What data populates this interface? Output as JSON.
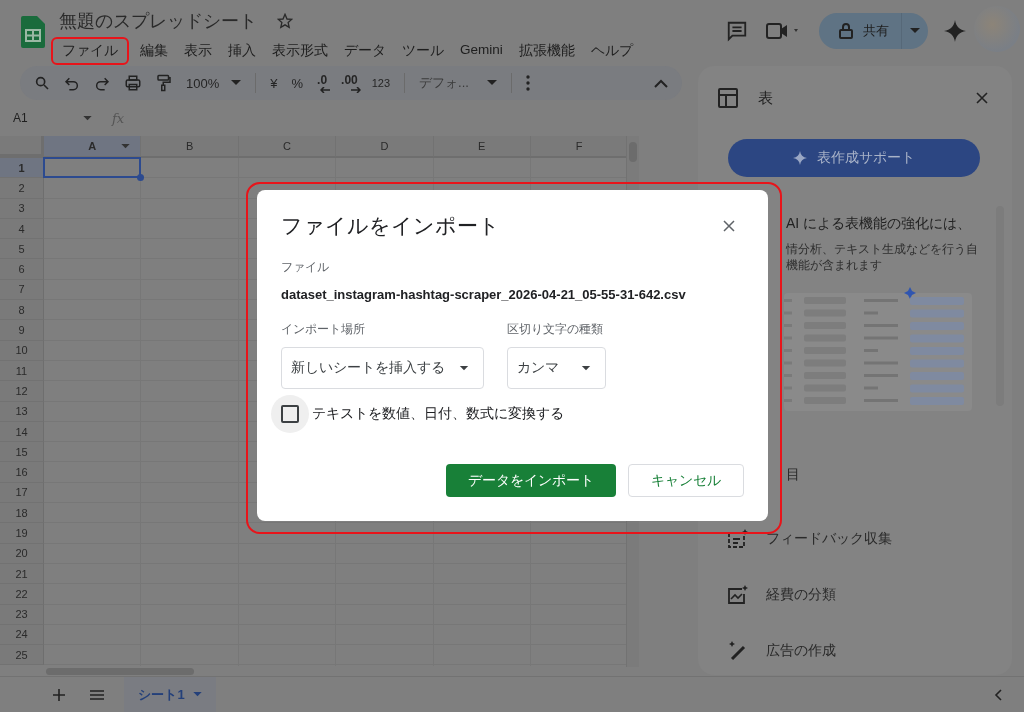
{
  "document": {
    "title": "無題のスプレッドシート",
    "starred": false
  },
  "menu": [
    {
      "label": "ファイル",
      "annotated": true
    },
    {
      "label": "編集",
      "annotated": false
    },
    {
      "label": "表示",
      "annotated": false
    },
    {
      "label": "挿入",
      "annotated": false
    },
    {
      "label": "表示形式",
      "annotated": false
    },
    {
      "label": "データ",
      "annotated": false
    },
    {
      "label": "ツール",
      "annotated": false
    },
    {
      "label": "Gemini",
      "annotated": false
    },
    {
      "label": "拡張機能",
      "annotated": false
    },
    {
      "label": "ヘルプ",
      "annotated": false
    }
  ],
  "share": {
    "label": "共有"
  },
  "toolbar": {
    "zoom": "100%",
    "currency": "¥",
    "percent": "%",
    "decrease_decimal": ".0",
    "increase_decimal": ".00",
    "number_format": "123",
    "font": "デフォ..."
  },
  "name_box": "A1",
  "formula_label": "fx",
  "grid": {
    "columns": [
      {
        "label": "A",
        "selected": true
      },
      {
        "label": "B",
        "selected": false
      },
      {
        "label": "C",
        "selected": false
      },
      {
        "label": "D",
        "selected": false
      },
      {
        "label": "E",
        "selected": false
      },
      {
        "label": "F",
        "selected": false
      }
    ],
    "rows": [
      {
        "label": "1",
        "selected": true
      },
      {
        "label": "2",
        "selected": false
      },
      {
        "label": "3",
        "selected": false
      },
      {
        "label": "4",
        "selected": false
      },
      {
        "label": "5",
        "selected": false
      },
      {
        "label": "6",
        "selected": false
      },
      {
        "label": "7",
        "selected": false
      },
      {
        "label": "8",
        "selected": false
      },
      {
        "label": "9",
        "selected": false
      },
      {
        "label": "10",
        "selected": false
      },
      {
        "label": "11",
        "selected": false
      },
      {
        "label": "12",
        "selected": false
      },
      {
        "label": "13",
        "selected": false
      },
      {
        "label": "14",
        "selected": false
      },
      {
        "label": "15",
        "selected": false
      },
      {
        "label": "16",
        "selected": false
      },
      {
        "label": "17",
        "selected": false
      },
      {
        "label": "18",
        "selected": false
      },
      {
        "label": "19",
        "selected": false
      },
      {
        "label": "20",
        "selected": false
      },
      {
        "label": "21",
        "selected": false
      },
      {
        "label": "22",
        "selected": false
      },
      {
        "label": "23",
        "selected": false
      },
      {
        "label": "24",
        "selected": false
      },
      {
        "label": "25",
        "selected": false
      }
    ]
  },
  "side_panel": {
    "title": "表",
    "primary_button": "表作成サポート",
    "intro": [
      "AI による表機能の強化には、",
      "情分析、テキスト生成などを行う自",
      "機能が含まれます"
    ],
    "items": [
      {
        "label": "目",
        "kind": "hidden"
      },
      {
        "label": "フィードバック収集",
        "kind": "feedback"
      },
      {
        "label": "経費の分類",
        "kind": "expense"
      },
      {
        "label": "広告の作成",
        "kind": "ad"
      }
    ]
  },
  "sheet_tabs": [
    {
      "label": "シート1",
      "selected": true
    }
  ],
  "dialog": {
    "title": "ファイルをインポート",
    "annotated": true,
    "file_label": "ファイル",
    "file_name": "dataset_instagram-hashtag-scraper_2026-04-21_05-55-31-642.csv",
    "fields": [
      {
        "label": "インポート場所",
        "value": "新しいシートを挿入する"
      },
      {
        "label": "区切り文字の種類",
        "value": "カンマ"
      }
    ],
    "option": {
      "label": "テキストを数値、日付、数式に変換する",
      "checked": false
    },
    "buttons": [
      {
        "label": "データをインポート",
        "kind": "primary"
      },
      {
        "label": "キャンセル",
        "kind": "secondary"
      }
    ]
  }
}
